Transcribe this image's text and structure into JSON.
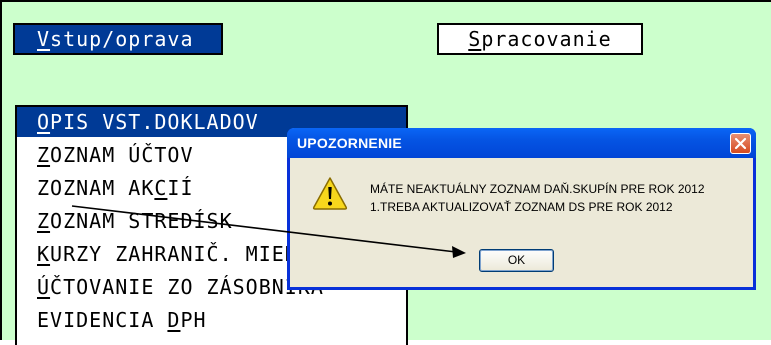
{
  "tabs": {
    "active": {
      "underline_letter": "V",
      "rest": "stup/oprava"
    },
    "inactive": {
      "underline_letter": "S",
      "rest": "pracovanie"
    }
  },
  "menu": {
    "items": [
      {
        "u": "O",
        "rest": "PIS VST.DOKLADOV",
        "selected": true
      },
      {
        "u": "Z",
        "rest": "OZNAM ÚČTOV"
      },
      {
        "pre": "ZOZNAM AK",
        "u": "C",
        "rest": "IÍ"
      },
      {
        "u": "Z",
        "rest": "OZNAM STREDÍSK"
      },
      {
        "u": "K",
        "rest": "URZY ZAHRANIČ. MIEN"
      },
      {
        "u": "Ú",
        "rest": "ČTOVANIE ZO ZÁSOBNÍKA"
      },
      {
        "pre": "EVIDENCIA ",
        "u": "D",
        "rest": "PH"
      }
    ]
  },
  "dialog": {
    "title": "UPOZORNENIE",
    "line1": "MÁTE NEAKTUÁLNY ZOZNAM DAŇ.SKUPÍN PRE ROK 2012",
    "line2": "1.TREBA AKTUALIZOVAŤ ZOZNAM DS PRE ROK 2012",
    "ok_label": "OK",
    "icon": "warning-icon",
    "close_icon": "close-icon"
  },
  "colors": {
    "background": "#ccffcc",
    "selection": "#003a96",
    "dialog_face": "#ece9d8",
    "titlebar": "#0554e3",
    "close": "#d64a20"
  }
}
